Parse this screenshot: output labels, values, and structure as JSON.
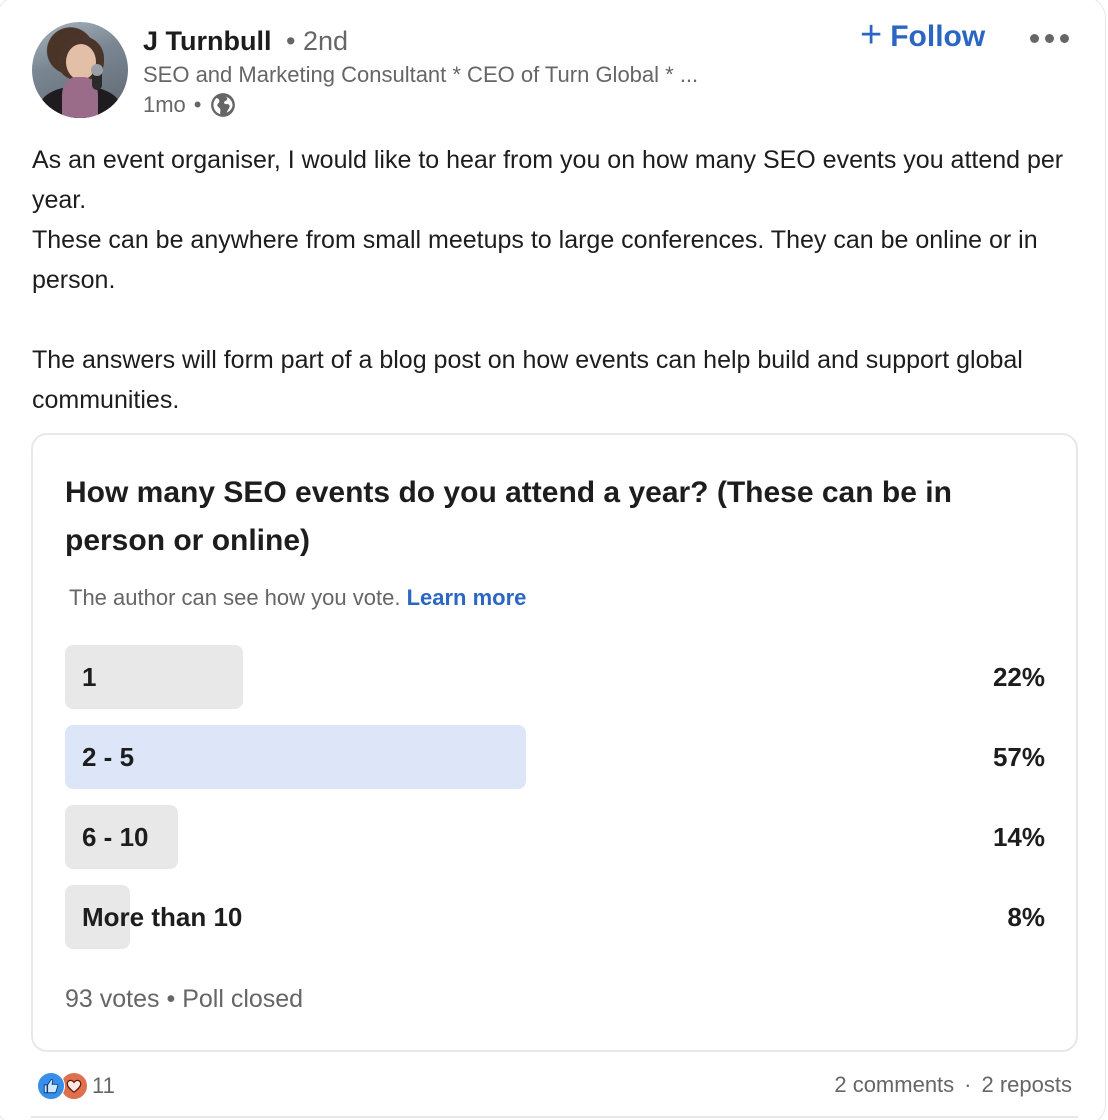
{
  "author": {
    "name": "J Turnbull",
    "degree": "• 2nd",
    "headline": "SEO and Marketing Consultant * CEO of Turn Global * ...",
    "time": "1mo",
    "time_sep": "•",
    "visibility_icon": "globe-icon"
  },
  "actions": {
    "follow_plus": "+",
    "follow_label": "Follow",
    "more_icon": "ellipsis-icon"
  },
  "post": {
    "paragraphs": [
      "As an event organiser, I would like to hear from you on how many SEO events you attend per year.",
      "These can be anywhere from small meetups to large conferences. They can be online or in person.",
      "The answers will form part of a blog post on how events can help build and support global communities."
    ]
  },
  "poll": {
    "question": "How many SEO events do you attend a year? (These can be in person or online)",
    "note": "The author can see how you vote.",
    "learn_more": "Learn more",
    "options": [
      {
        "label": "1",
        "percent_text": "22%",
        "percent": 22,
        "selected": false
      },
      {
        "label": "2 - 5",
        "percent_text": "57%",
        "percent": 57,
        "selected": true
      },
      {
        "label": "6 - 10",
        "percent_text": "14%",
        "percent": 14,
        "selected": false
      },
      {
        "label": "More than 10",
        "percent_text": "8%",
        "percent": 8,
        "selected": false
      }
    ],
    "votes": "93 votes",
    "sep": "•",
    "status": "Poll closed"
  },
  "social": {
    "reaction_icons": [
      "like-icon",
      "love-icon"
    ],
    "reaction_count": "11",
    "comments": "2 comments",
    "sep": "·",
    "reposts": "2 reposts"
  },
  "colors": {
    "accent": "#2a66c2",
    "selected_bar": "#dce6f8",
    "bar": "#e8e8e8",
    "like": "#378fe9",
    "love": "#df704d"
  }
}
